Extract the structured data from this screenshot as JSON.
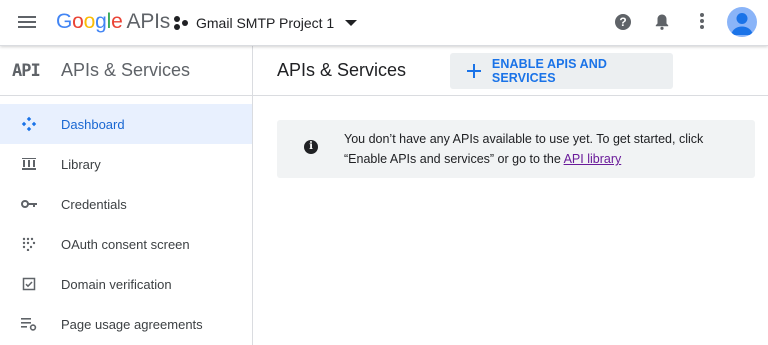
{
  "header": {
    "logo_google": [
      "G",
      "o",
      "o",
      "g",
      "l",
      "e"
    ],
    "logo_apis": "APIs",
    "project_name": "Gmail SMTP Project 1",
    "help_glyph": "?"
  },
  "sidebar": {
    "badge": "API",
    "title": "APIs & Services",
    "items": [
      {
        "label": "Dashboard",
        "icon": "dashboard-icon",
        "active": true
      },
      {
        "label": "Library",
        "icon": "library-icon"
      },
      {
        "label": "Credentials",
        "icon": "key-icon"
      },
      {
        "label": "OAuth consent screen",
        "icon": "oauth-consent-icon"
      },
      {
        "label": "Domain verification",
        "icon": "domain-check-icon"
      },
      {
        "label": "Page usage agreements",
        "icon": "settings-list-icon"
      }
    ]
  },
  "main": {
    "title": "APIs & Services",
    "enable_button": "ENABLE APIS AND SERVICES",
    "notice": {
      "info_glyph": "i",
      "line1": "You don’t have any APIs available to use yet. To get started, click",
      "line2_prefix": "“Enable APIs and services” or go to the ",
      "link": "API library"
    }
  },
  "colors": {
    "accent": "#1a73e8",
    "active_bg": "#e8f0fe",
    "notice_bg": "#f1f3f4",
    "link_visited": "#6a1b9a"
  }
}
